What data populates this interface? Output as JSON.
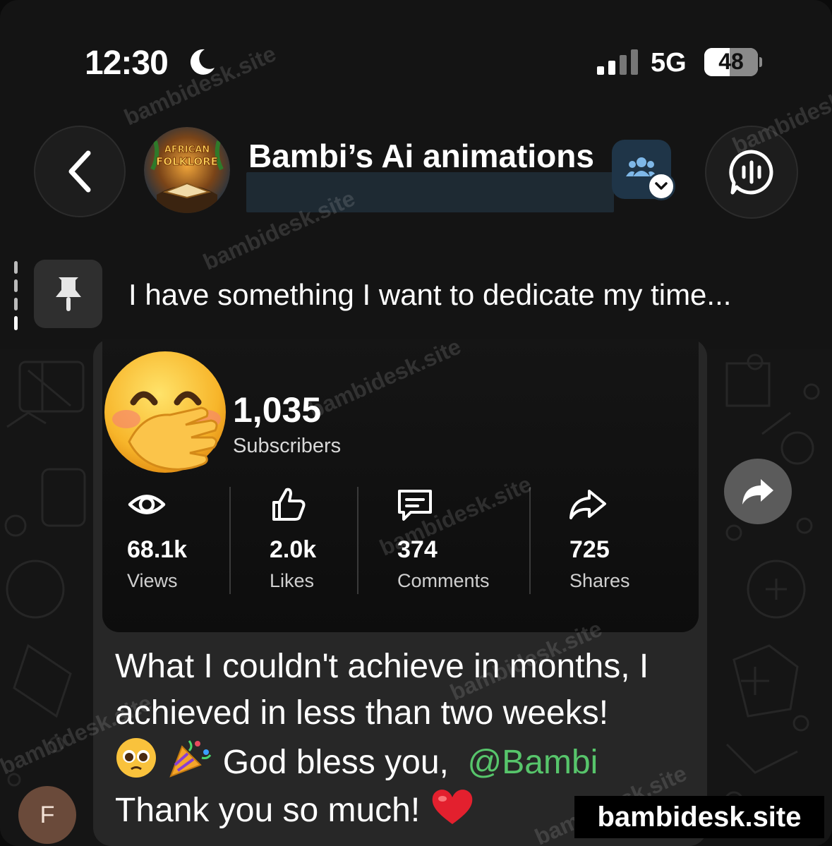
{
  "status_bar": {
    "time": "12:30",
    "network": "5G",
    "battery": "48",
    "battery_level": 0.48
  },
  "header": {
    "channel_name": "Bambi’s Ai animations",
    "logo_line1": "AFRICAN",
    "logo_line2": "FOLKLORE"
  },
  "pinned": {
    "text": "I have something I want to dedicate my time..."
  },
  "stats": {
    "subscribers_count": "1,035",
    "subscribers_label": "Subscribers",
    "items": [
      {
        "icon": "eye-icon",
        "value": "68.1k",
        "label": "Views"
      },
      {
        "icon": "thumbs-up-icon",
        "value": "2.0k",
        "label": "Likes"
      },
      {
        "icon": "comment-icon",
        "value": "374",
        "label": "Comments"
      },
      {
        "icon": "share-icon",
        "value": "725",
        "label": "Shares"
      }
    ]
  },
  "message": {
    "line1": "What I couldn't achieve in months, I",
    "line2": "achieved in less than two weeks!",
    "line3_text": "God bless you,",
    "mention": "@Bambi",
    "line4": "Thank you so much!"
  },
  "user": {
    "avatar_initial": "F"
  },
  "watermark": {
    "text": "bambidesk.site",
    "brand": "bambidesk.site"
  },
  "colors": {
    "mention": "#57c56b",
    "bubble": "#272727",
    "background": "#121212"
  }
}
